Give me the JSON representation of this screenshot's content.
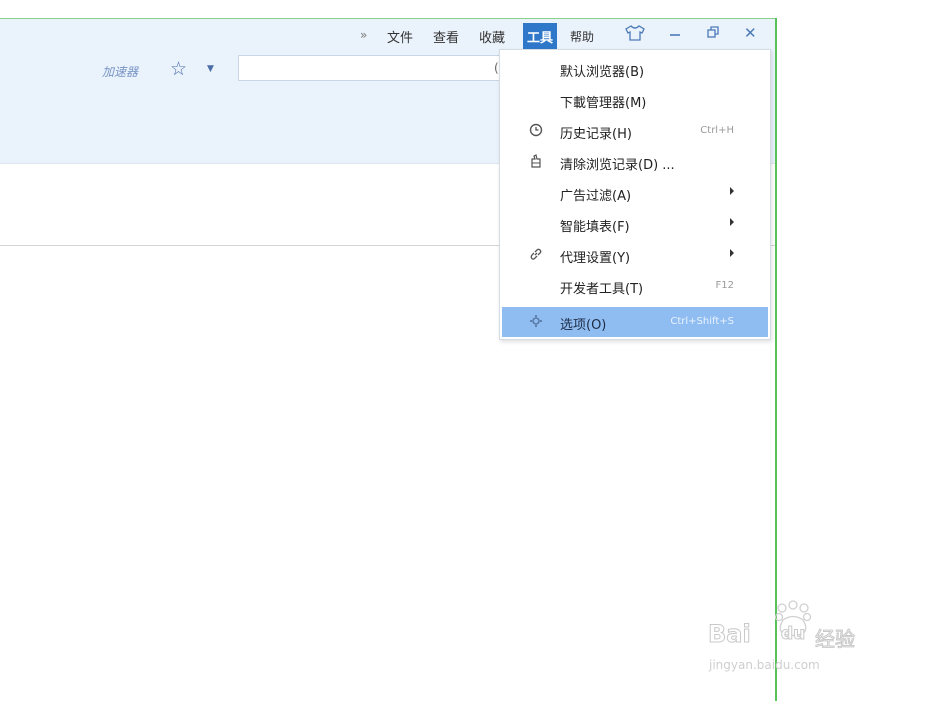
{
  "menubar": {
    "more": "»",
    "items": [
      "文件",
      "查看",
      "收藏",
      "工具",
      "帮助"
    ],
    "active_item": "工具"
  },
  "window_controls": {
    "skin_icon": "shirt-icon",
    "minimize_icon": "minimize-icon",
    "restore_icon": "restore-icon",
    "close_icon": "close-icon",
    "minimize": "—",
    "close": "✕"
  },
  "toolbar": {
    "accelerator_label": "加速器",
    "star_icon": "star-icon",
    "search_value": "",
    "search_partial": "("
  },
  "tools_menu": {
    "items": [
      {
        "label": "默认浏览器(B)",
        "icon": "",
        "shortcut": "",
        "submenu": false
      },
      {
        "label": "下載管理器(M)",
        "icon": "",
        "shortcut": "",
        "submenu": false
      },
      {
        "label": "历史记录(H)",
        "icon": "clock-icon",
        "shortcut": "Ctrl+H",
        "submenu": false
      },
      {
        "label": "清除浏览记录(D) ...",
        "icon": "broom-icon",
        "shortcut": "",
        "submenu": false
      },
      {
        "label": "广告过滤(A)",
        "icon": "",
        "shortcut": "",
        "submenu": true
      },
      {
        "label": "智能填表(F)",
        "icon": "",
        "shortcut": "",
        "submenu": true
      },
      {
        "label": "代理设置(Y)",
        "icon": "link-icon",
        "shortcut": "",
        "submenu": true
      },
      {
        "label": "开发者工具(T)",
        "icon": "",
        "shortcut": "F12",
        "submenu": false
      },
      {
        "label": "选项(O)",
        "icon": "gear-icon",
        "shortcut": "Ctrl+Shift+S",
        "submenu": false,
        "highlighted": true
      }
    ]
  },
  "watermark": {
    "brand": "Bai",
    "brand_du": "du",
    "product": "经验",
    "url": "jingyan.baidu.com"
  },
  "colors": {
    "accent": "#2f77c9",
    "highlight": "#90bdf1",
    "chrome_bg": "#eaf2fb",
    "frame_green": "#57c257"
  }
}
